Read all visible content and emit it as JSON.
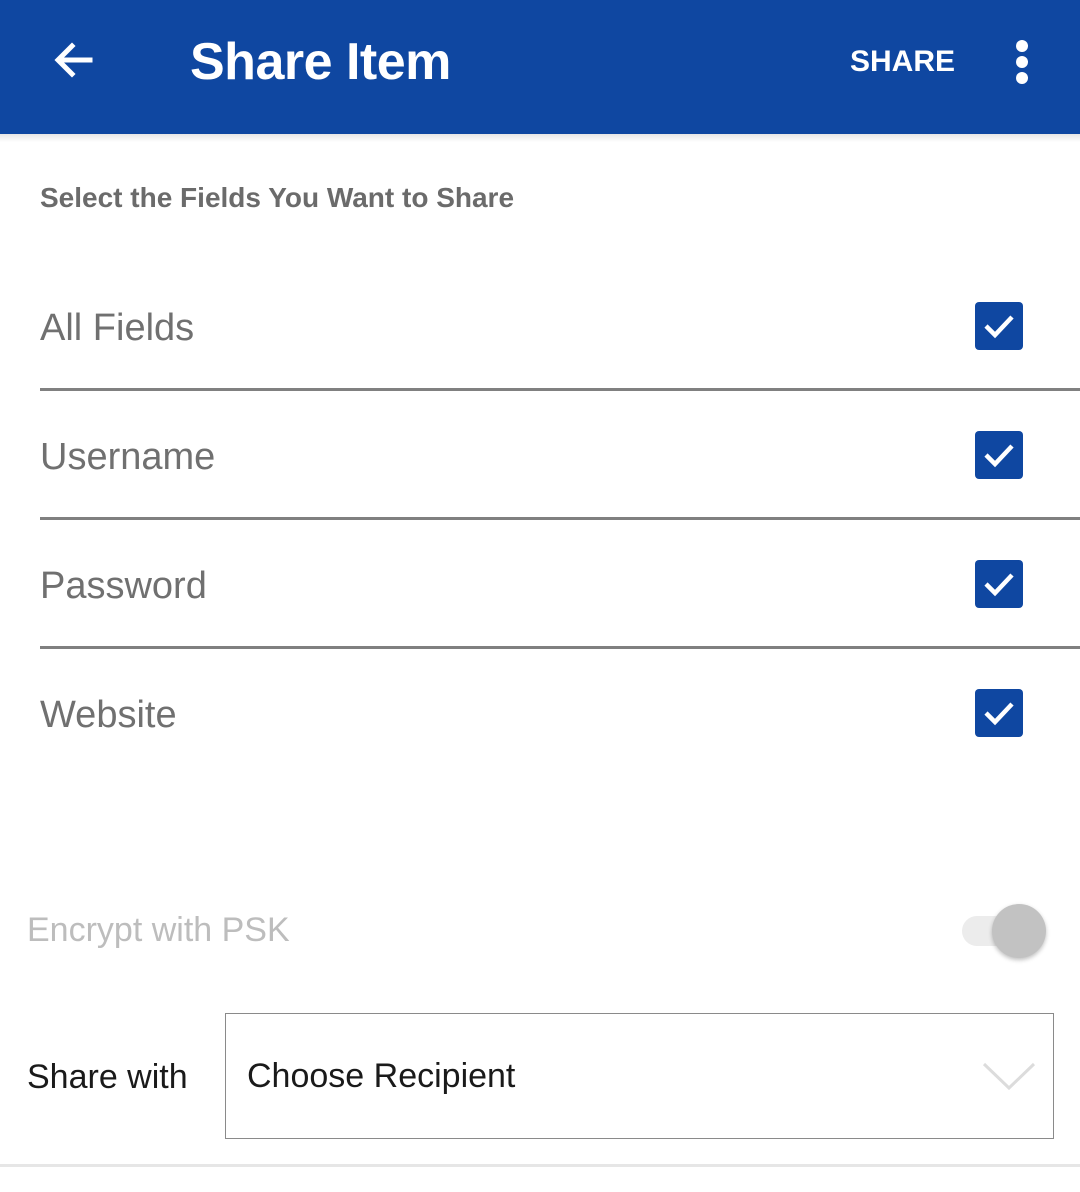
{
  "appbar": {
    "title": "Share Item",
    "share_label": "SHARE",
    "color": "#0f47a1",
    "icons": {
      "back": "arrow-left-icon",
      "more": "more-vertical-icon"
    }
  },
  "fields_section": {
    "title": "Select the Fields You Want to Share",
    "items": [
      {
        "label": "All Fields",
        "checked": true
      },
      {
        "label": "Username",
        "checked": true
      },
      {
        "label": "Password",
        "checked": true
      },
      {
        "label": "Website",
        "checked": true
      }
    ]
  },
  "encrypt": {
    "label": "Encrypt with PSK",
    "enabled": false,
    "on": false
  },
  "share_with": {
    "label": "Share with",
    "select_value": "Choose Recipient",
    "icon": "chevron-down-icon"
  }
}
